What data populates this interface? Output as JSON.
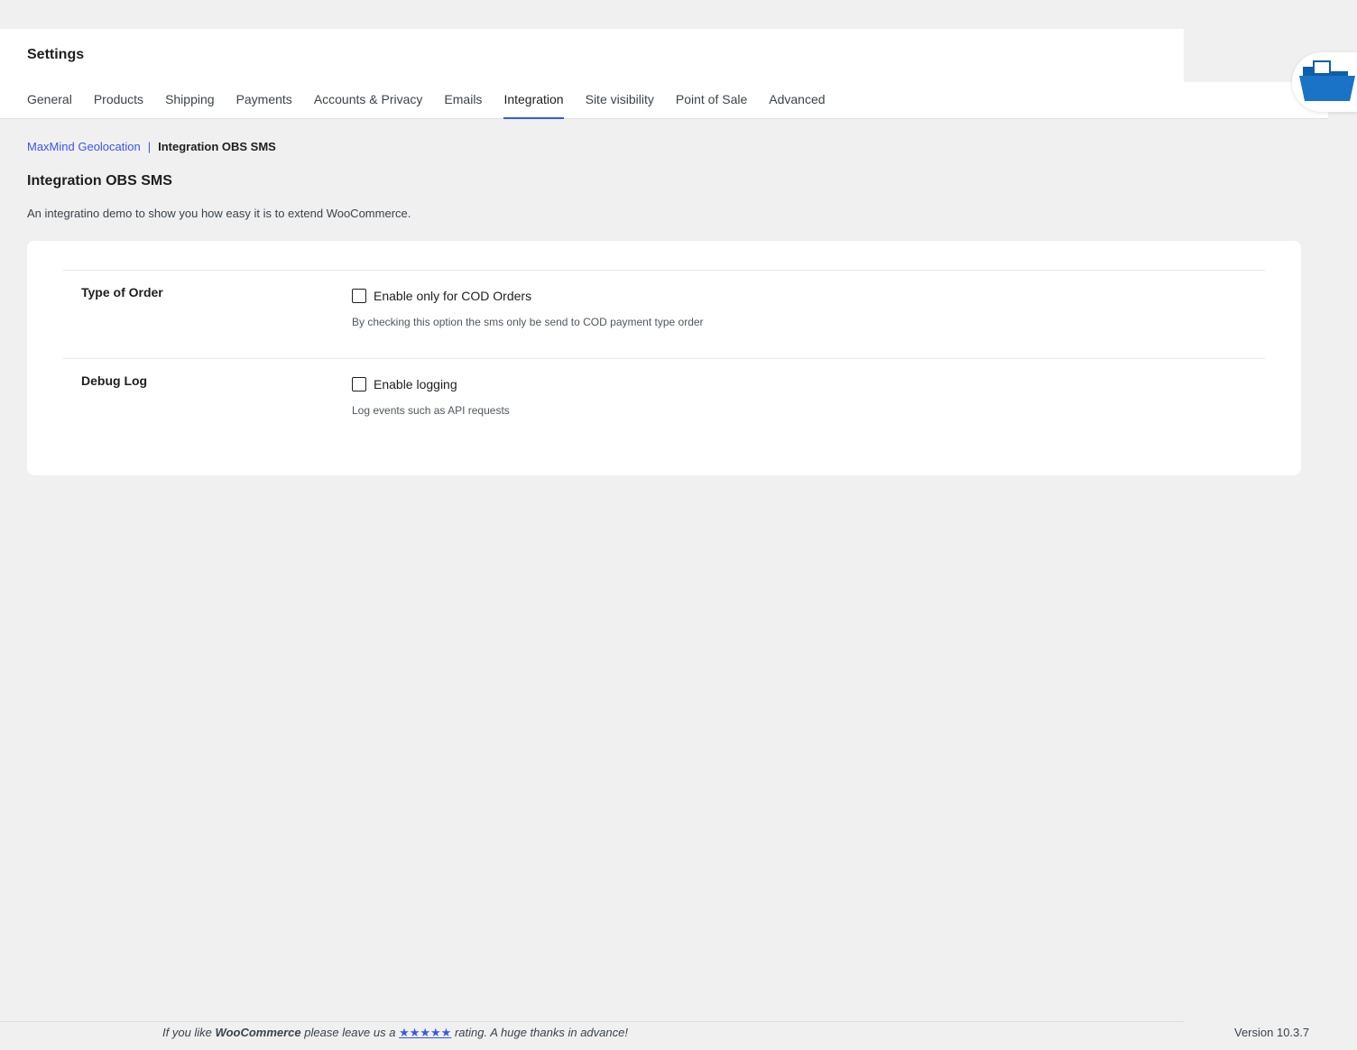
{
  "header": {
    "title": "Settings",
    "tabs": [
      {
        "label": "General"
      },
      {
        "label": "Products"
      },
      {
        "label": "Shipping"
      },
      {
        "label": "Payments"
      },
      {
        "label": "Accounts & Privacy"
      },
      {
        "label": "Emails"
      },
      {
        "label": "Integration",
        "active": true
      },
      {
        "label": "Site visibility"
      },
      {
        "label": "Point of Sale"
      },
      {
        "label": "Advanced"
      }
    ]
  },
  "breadcrumb": {
    "link": "MaxMind Geolocation",
    "separator": "|",
    "current": "Integration OBS SMS"
  },
  "section": {
    "title": "Integration OBS SMS",
    "description": "An integratino demo to show you how easy it is to extend WooCommerce."
  },
  "settings": {
    "type_of_order": {
      "label": "Type of Order",
      "checkbox_label": "Enable only for COD Orders",
      "checked": false,
      "help": "By checking this option the sms only be send to COD payment type order"
    },
    "debug_log": {
      "label": "Debug Log",
      "checkbox_label": "Enable logging",
      "checked": false,
      "help": "Log events such as API requests"
    }
  },
  "footer": {
    "prefix": "If you like ",
    "brand": "WooCommerce",
    "middle": " please leave us a ",
    "stars": "★★★★★",
    "suffix": " rating. A huge thanks in advance!",
    "version": "Version 10.3.7"
  },
  "icons": {
    "folder_badge": "folder-open-icon"
  },
  "colors": {
    "accent": "#3858e9",
    "folder": "#1a73c6",
    "background": "#f0f0f1"
  }
}
